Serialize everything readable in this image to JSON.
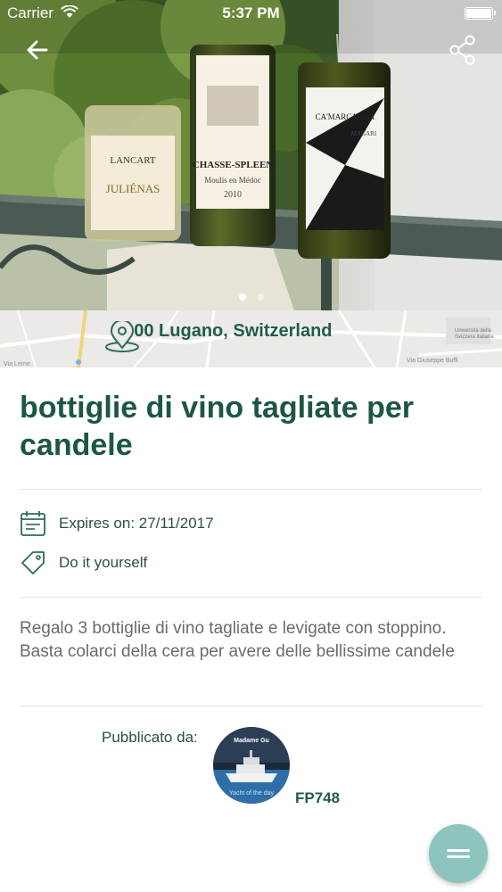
{
  "status_bar": {
    "carrier": "Carrier",
    "time": "5:37 PM"
  },
  "gallery": {
    "image_count": 2,
    "active_index": 0
  },
  "location": {
    "text": "6900 Lugano, Switzerland"
  },
  "map_labels": {
    "street_1": "Via Lerne",
    "street_2": "Via Giuseppe Buffi",
    "poi": "Università della Svizzera italiana"
  },
  "photo_labels": {
    "bottle_1_brand": "LANCART",
    "bottle_1_name": "JULIÉNAS",
    "bottle_2_brand": "CHASSE-SPLEEN",
    "bottle_2_sub": "Moulis en Médoc",
    "bottle_2_year": "2010",
    "bottle_3_brand": "CA'MARCANDA",
    "bottle_3_name": "MAGARI"
  },
  "listing": {
    "title": "bottiglie di vino tagliate per candele",
    "expires": "Expires on: 27/11/2017",
    "category": "Do it yourself",
    "description": "Regalo 3 bottiglie di vino tagliate e levigate con stoppino. Basta colarci della cera per avere delle bellissime candele"
  },
  "publisher": {
    "label": "Pubblicato da:",
    "avatar_top_text": "Madame Gu",
    "avatar_bottom_text": "Yacht of the day",
    "username": "FP748"
  },
  "colors": {
    "accent": "#1d5647",
    "fab": "#8ec4be",
    "map_bg": "#eceae6"
  },
  "icons": {
    "back": "arrow-left-icon",
    "share": "share-icon",
    "location": "map-pin-icon",
    "calendar": "calendar-icon",
    "tag": "tag-icon",
    "menu": "menu-icon"
  }
}
